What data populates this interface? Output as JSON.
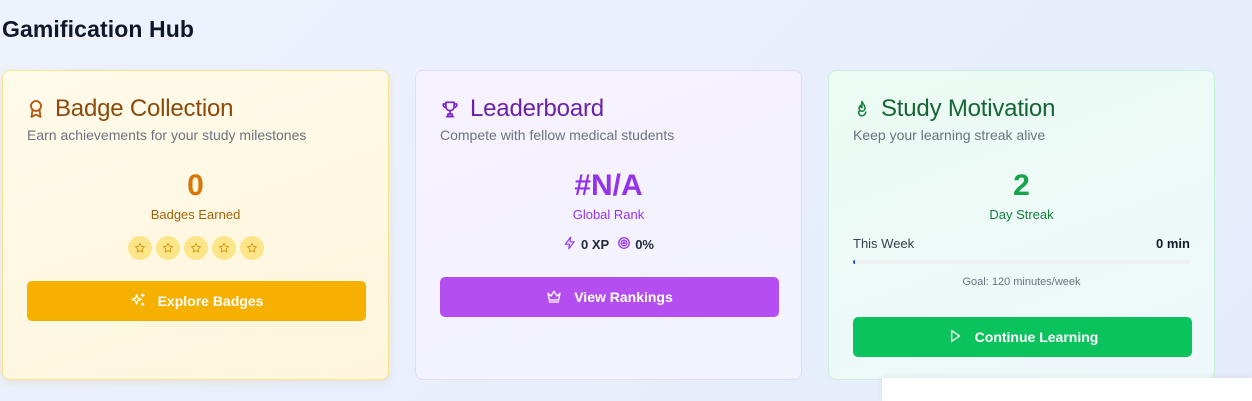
{
  "page": {
    "title": "Gamification Hub"
  },
  "badges": {
    "icon": "award-icon",
    "title": "Badge Collection",
    "subtitle": "Earn achievements for your study milestones",
    "count": "0",
    "count_label": "Badges Earned",
    "star_slots": 5,
    "button_label": "Explore Badges",
    "button_icon": "sparkles-icon",
    "accent": "#f5b000"
  },
  "leaderboard": {
    "icon": "trophy-icon",
    "title": "Leaderboard",
    "subtitle": "Compete with fellow medical students",
    "rank": "#N/A",
    "rank_label": "Global Rank",
    "xp": "0 XP",
    "percent": "0%",
    "button_label": "View Rankings",
    "button_icon": "crown-icon",
    "accent": "#b54ef0"
  },
  "study": {
    "icon": "flame-icon",
    "title": "Study Motivation",
    "subtitle": "Keep your learning streak alive",
    "streak": "2",
    "streak_label": "Day Streak",
    "week_label": "This Week",
    "week_value": "0 min",
    "progress_fraction": 0.0,
    "goal": "Goal: 120 minutes/week",
    "button_label": "Continue Learning",
    "button_icon": "play-icon",
    "accent": "#0ac35c"
  }
}
